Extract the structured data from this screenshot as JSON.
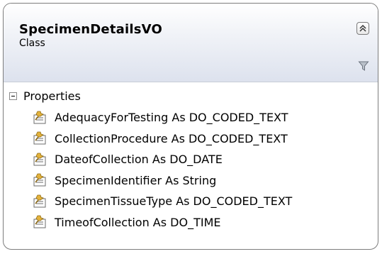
{
  "class_shape": {
    "name": "SpecimenDetailsVO",
    "kind": "Class",
    "collapse_icon": "double-chevron-up-icon",
    "filter_icon": "funnel-icon"
  },
  "properties_section": {
    "title": "Properties",
    "toggle_icon": "minus-box-icon",
    "item_icon": "property-icon",
    "items": [
      {
        "text": "AdequacyForTesting As DO_CODED_TEXT"
      },
      {
        "text": "CollectionProcedure As DO_CODED_TEXT"
      },
      {
        "text": "DateofCollection As DO_DATE"
      },
      {
        "text": "SpecimenIdentifier As String"
      },
      {
        "text": "SpecimenTissueType As DO_CODED_TEXT"
      },
      {
        "text": "TimeofCollection As DO_TIME"
      }
    ]
  }
}
